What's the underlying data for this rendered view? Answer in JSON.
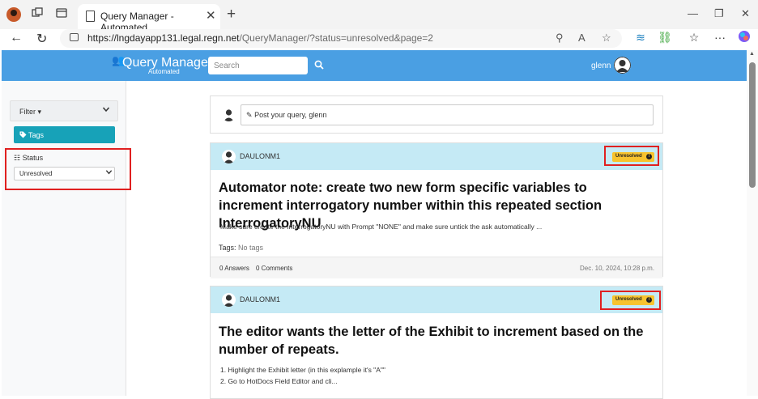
{
  "browser": {
    "tab_title": "Query Manager - Automated",
    "url_host": "https://lngdayapp131.legal.regn.net",
    "url_path": "/QueryManager/?status=unresolved&page=2"
  },
  "header": {
    "brand": "Query Manager",
    "brand_sub": "Automated",
    "search_placeholder": "Search",
    "user": "glenn"
  },
  "sidebar": {
    "filter_label": "Filter ▾",
    "tags_label": "Tags",
    "status_label": "Status",
    "status_value": "Unresolved"
  },
  "post": {
    "prompt": "Post your query, glenn"
  },
  "queries": [
    {
      "author": "DAULONM1",
      "status": "Unresolved",
      "title": "Automator note: create two new form specific variables to increment interrogatory number within this repeated section InterrogatoryNU",
      "body": "Make sure create the InterrogatoryNU with Prompt \"NONE\" and make sure untick the ask automatically ...",
      "tags_label": "Tags:",
      "tags_value": "No tags",
      "answers": "0 Answers",
      "comments": "0 Comments",
      "date": "Dec. 10, 2024, 10:28 p.m."
    },
    {
      "author": "DAULONM1",
      "status": "Unresolved",
      "title": "The editor wants the letter of the Exhibit to increment based on the number of repeats.",
      "body_line1": "1. Highlight the Exhibit letter (in this explample it's \"A\"\"",
      "body_line2": "2. Go to HotDocs Field Editor and cli..."
    }
  ],
  "colors": {
    "header_blue": "#4a9fe3",
    "card_head": "#c5eaf5",
    "badge": "#f7c32e",
    "tags_button": "#17a2b8",
    "highlight": "#e02020"
  }
}
